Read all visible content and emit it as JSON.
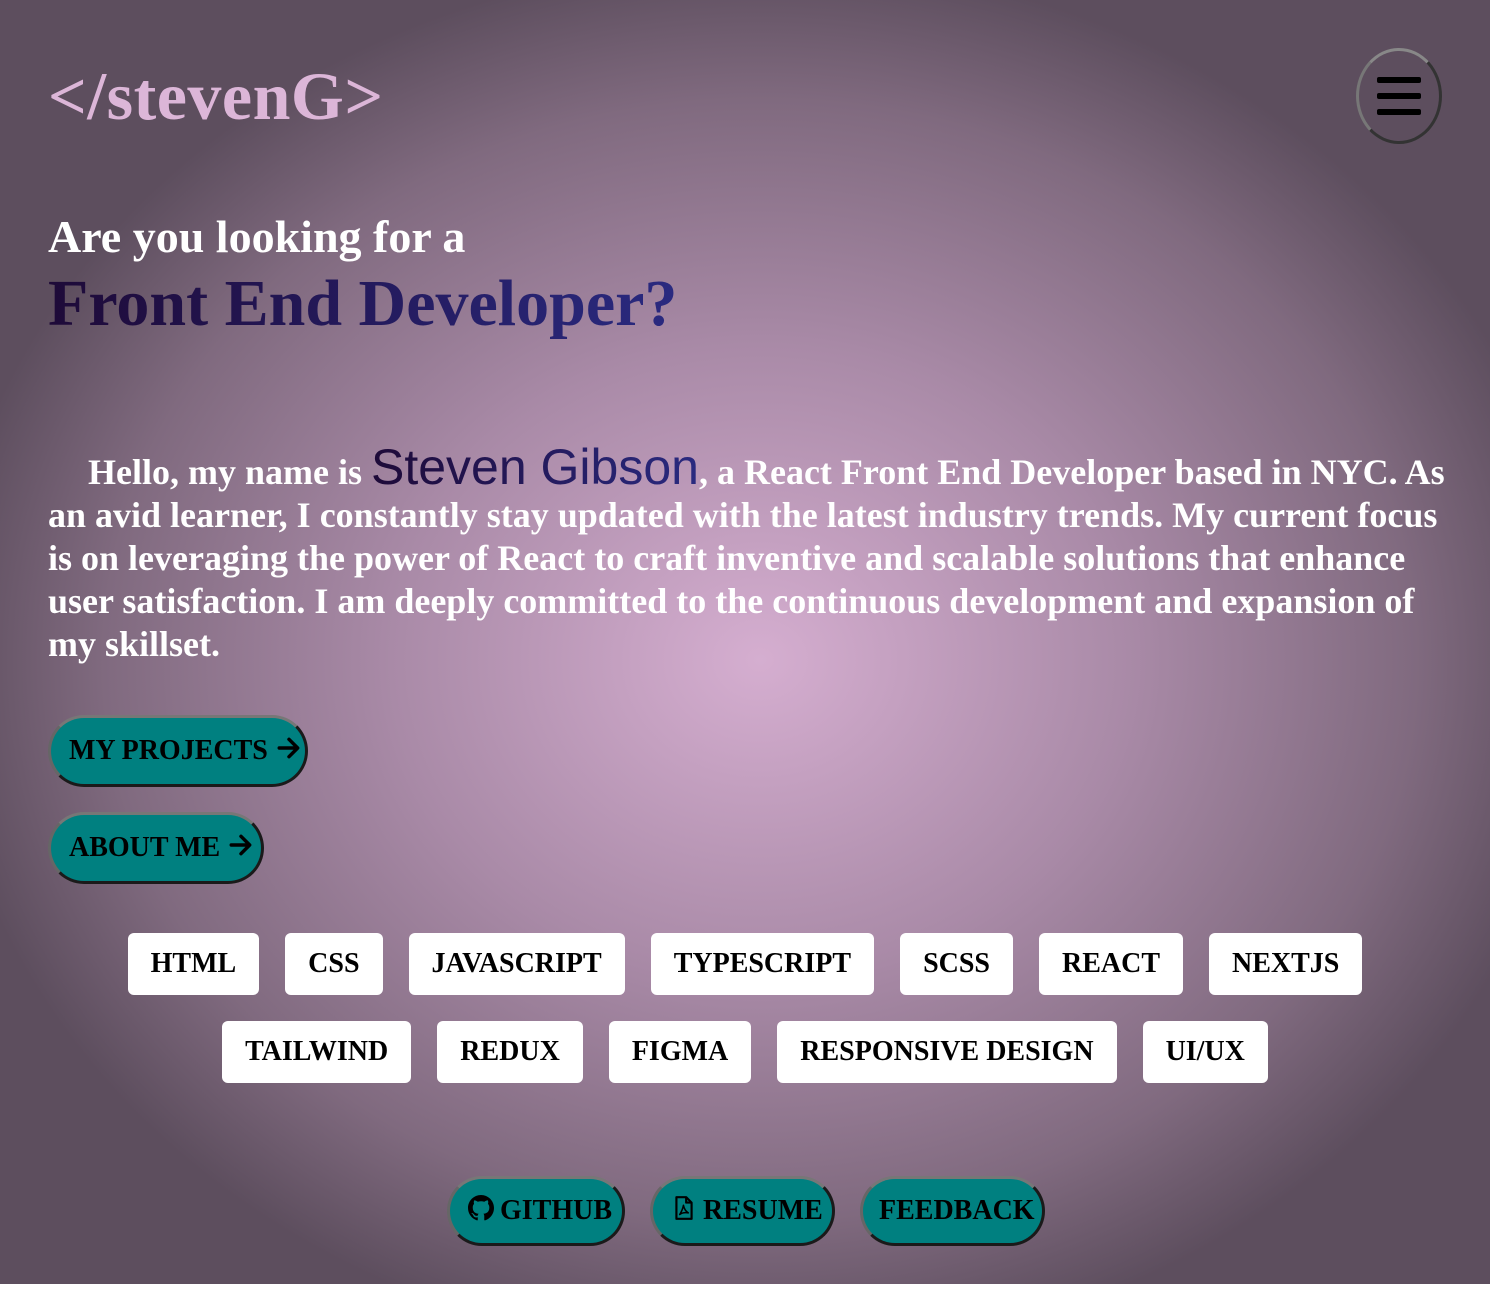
{
  "header": {
    "logo": "</stevenG>",
    "menu_icon": "hamburger-menu-icon"
  },
  "hero": {
    "subtitle": "Are you looking for a",
    "title": "Front End Developer?"
  },
  "intro": {
    "prefix": "Hello, my name is ",
    "name": "Steven Gibson",
    "suffix": ", a React Front End Developer based in NYC. As an avid learner, I constantly stay updated with the latest industry trends. My current focus is on leveraging the power of React to craft inventive and scalable solutions that enhance user satisfaction. I am deeply committed to the continuous development and expansion of my skillset."
  },
  "actions": {
    "projects_label": "MY PROJECTS",
    "about_label": "ABOUT ME",
    "arrow_icon": "arrow-right-icon"
  },
  "skills": {
    "row1": [
      "HTML",
      "CSS",
      "JAVASCRIPT",
      "TYPESCRIPT",
      "SCSS",
      "REACT",
      "NEXTJS"
    ],
    "row2": [
      "TAILWIND",
      "REDUX",
      "FIGMA",
      "RESPONSIVE DESIGN",
      "UI/UX"
    ]
  },
  "footer_links": {
    "github_label": "GITHUB",
    "github_icon": "github-icon",
    "resume_label": "RESUME",
    "resume_icon": "pdf-file-icon",
    "feedback_label": "FEEDBACK"
  },
  "colors": {
    "accent_button": "#008080",
    "logo": "#dcb6d8",
    "title_gradient_start": "#1e0a38",
    "title_gradient_end": "#2a2a80"
  }
}
